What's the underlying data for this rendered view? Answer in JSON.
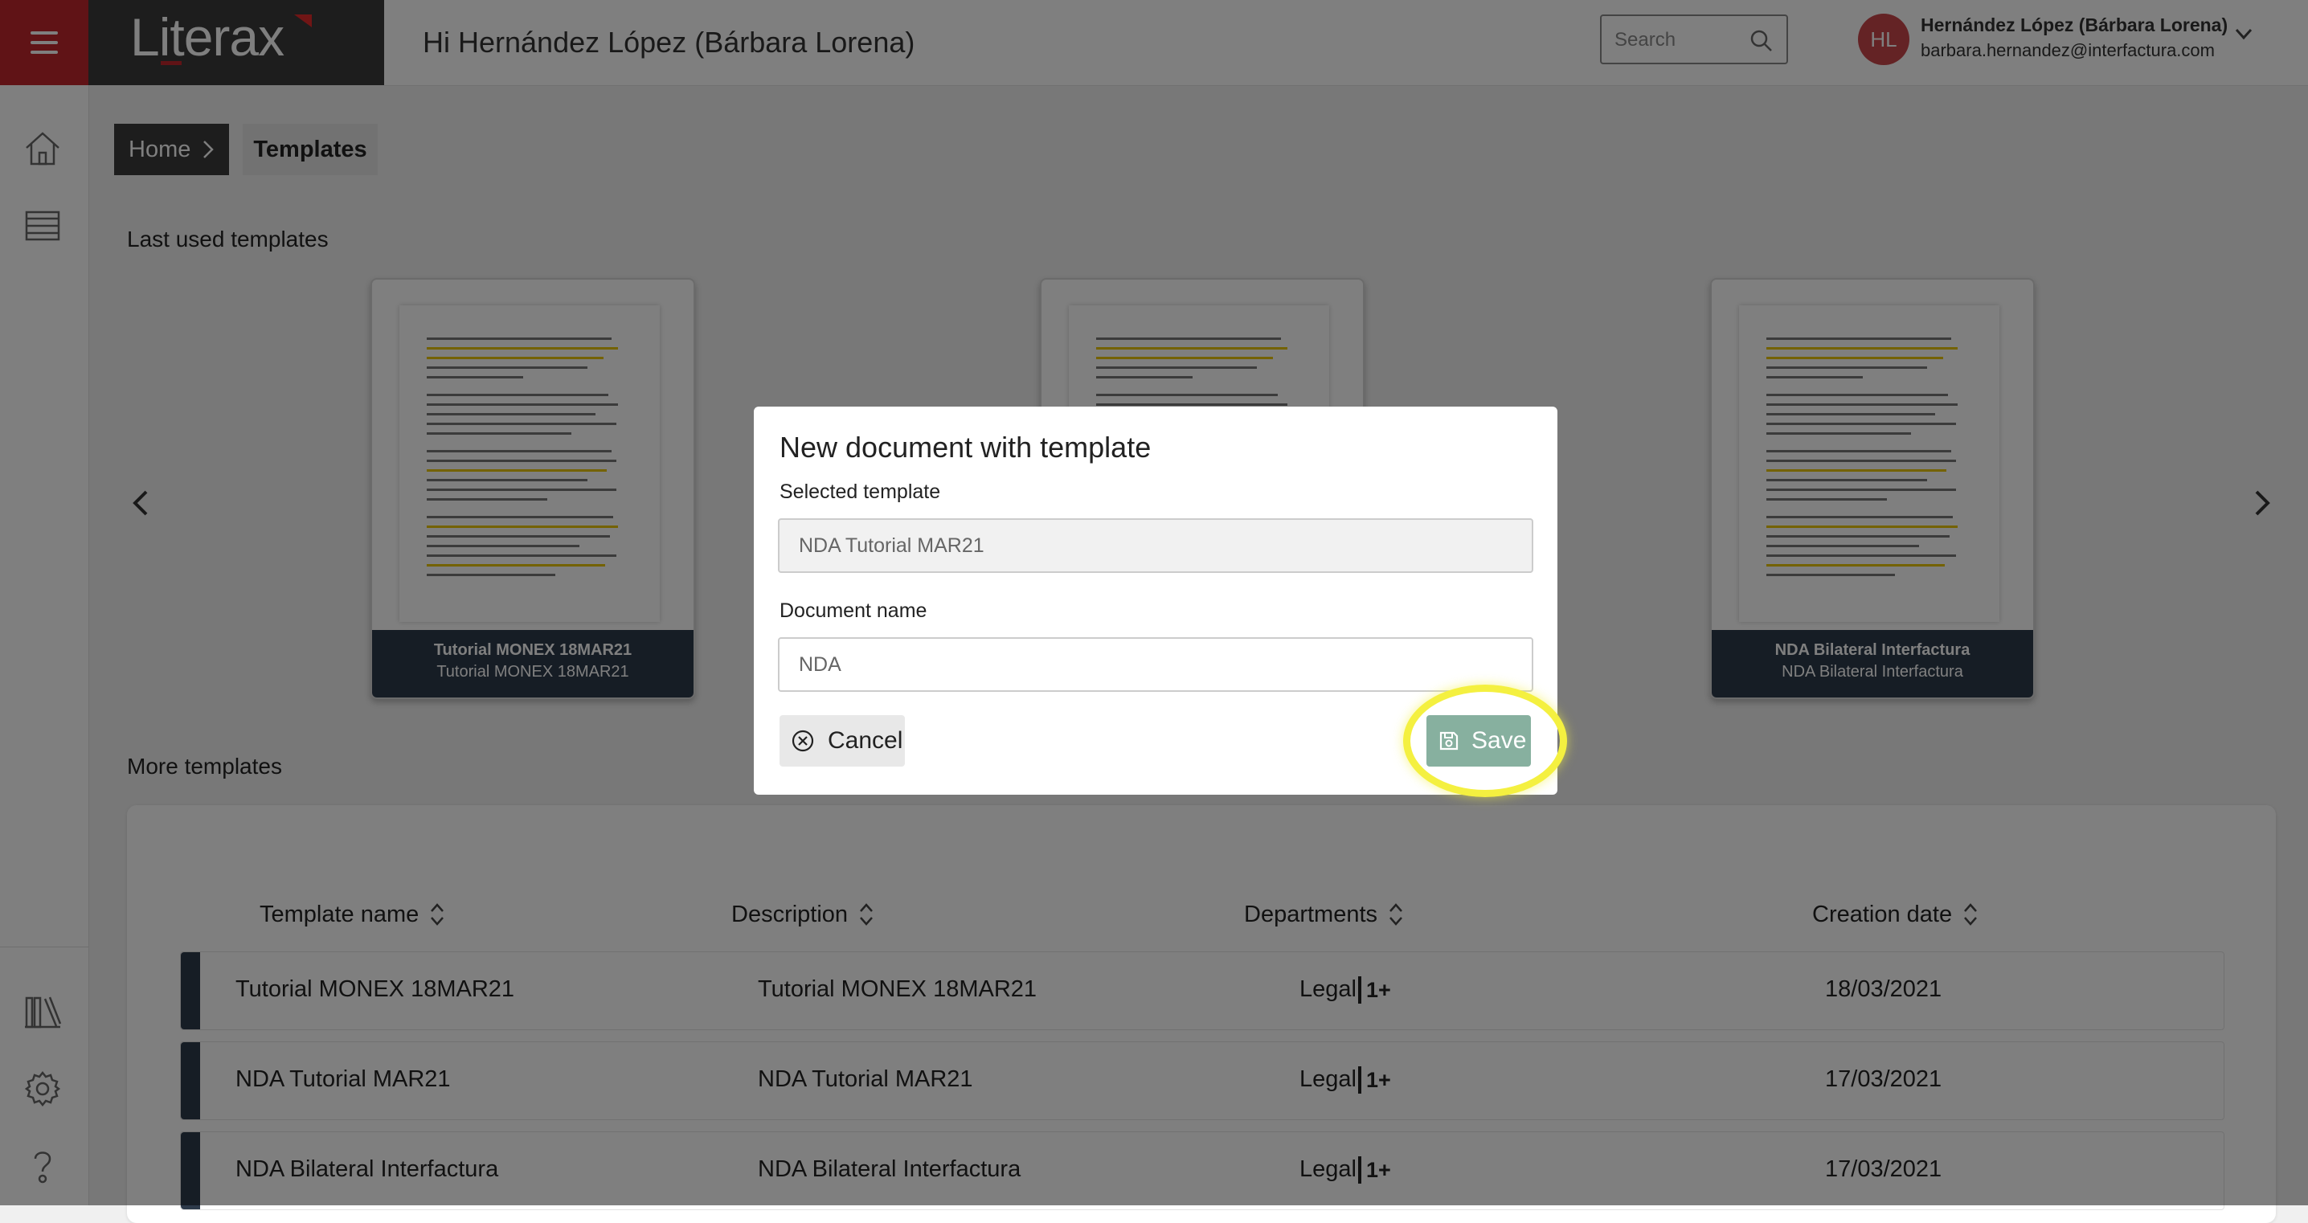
{
  "app": {
    "logo_text": "Literax"
  },
  "header": {
    "greeting": "Hi Hernández López (Bárbara Lorena)",
    "search_placeholder": "Search",
    "user": {
      "initials": "HL",
      "name": "Hernández López (Bárbara Lorena)",
      "email": "barbara.hernandez@interfactura.com"
    }
  },
  "breadcrumb": {
    "home": "Home",
    "current": "Templates"
  },
  "last_used": {
    "title": "Last used templates",
    "cards": [
      {
        "title": "Tutorial MONEX 18MAR21",
        "subtitle": "Tutorial MONEX 18MAR21"
      },
      {
        "title": "",
        "subtitle": ""
      },
      {
        "title": "NDA Bilateral Interfactura",
        "subtitle": "NDA Bilateral Interfactura"
      }
    ]
  },
  "more_templates": {
    "title": "More templates",
    "columns": [
      "Template name",
      "Description",
      "Departments",
      "Creation date"
    ],
    "rows": [
      {
        "name": "Tutorial MONEX 18MAR21",
        "description": "Tutorial MONEX 18MAR21",
        "department": "Legal",
        "more": "1+",
        "date": "18/03/2021"
      },
      {
        "name": "NDA Tutorial MAR21",
        "description": "NDA Tutorial MAR21",
        "department": "Legal",
        "more": "1+",
        "date": "17/03/2021"
      },
      {
        "name": "NDA Bilateral Interfactura",
        "description": "NDA Bilateral Interfactura",
        "department": "Legal",
        "more": "1+",
        "date": "17/03/2021"
      }
    ]
  },
  "modal": {
    "title": "New document with template",
    "selected_template_label": "Selected template",
    "selected_template_value": "NDA Tutorial MAR21",
    "document_name_label": "Document name",
    "document_name_value": "NDA",
    "cancel_label": "Cancel",
    "save_label": "Save"
  },
  "colors": {
    "brand_red": "#c1272d",
    "dark": "#3a3a3a",
    "navy": "#2d3a4a",
    "save_green": "#87b09f",
    "highlight_yellow": "#f4f040"
  },
  "icons": [
    "menu-icon",
    "search-icon",
    "chevron-down-icon",
    "home-icon",
    "table-icon",
    "library-icon",
    "gear-icon",
    "help-icon",
    "chevron-right-icon",
    "chevron-left-icon",
    "sort-icon",
    "cancel-circle-icon",
    "save-icon"
  ]
}
